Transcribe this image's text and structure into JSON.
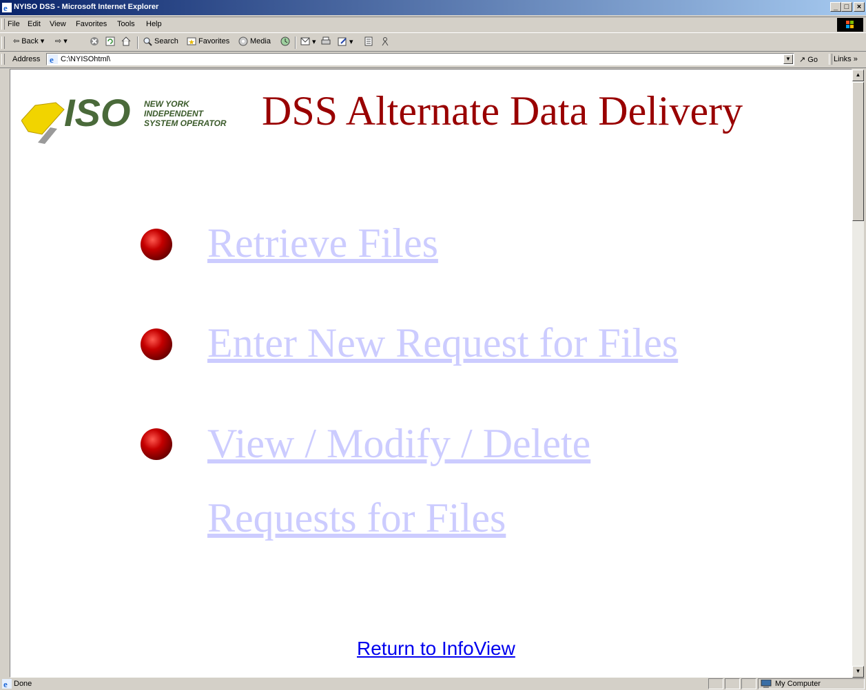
{
  "window": {
    "title": "NYISO DSS - Microsoft Internet Explorer",
    "controls": [
      "_",
      "□",
      "×"
    ]
  },
  "menubar": {
    "items": [
      "File",
      "Edit",
      "View",
      "Favorites",
      "Tools",
      "Help"
    ]
  },
  "toolbar": {
    "back_label": "Back",
    "search_label": "Search",
    "favorites_label": "Favorites",
    "media_label": "Media"
  },
  "addressbar": {
    "label": "Address",
    "value": "C:\\NYISOhtml\\",
    "go_label": "Go",
    "links_label": "Links »"
  },
  "page": {
    "logo_text_line1": "NEW YORK",
    "logo_text_line2": "INDEPENDENT",
    "logo_text_line3": "SYSTEM OPERATOR",
    "logo_iso": "ISO",
    "heading": "DSS Alternate Data Delivery",
    "links": [
      {
        "line1": "Retrieve Files"
      },
      {
        "line1": "Enter New Request for Files"
      },
      {
        "line1": "View / Modify / Delete",
        "line2": "Requests for Files"
      }
    ],
    "return_link": "Return to InfoView"
  },
  "statusbar": {
    "status": "Done",
    "zone": "My Computer"
  },
  "colors": {
    "heading": "#990000",
    "link_visited_faded": "#ccccff",
    "link": "#0000ee"
  }
}
